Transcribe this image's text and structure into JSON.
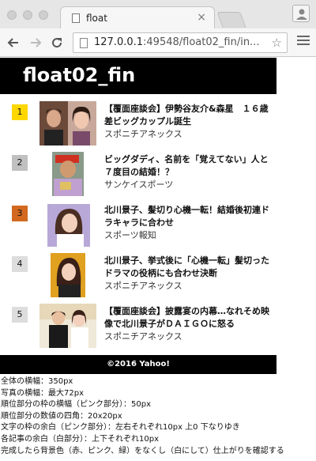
{
  "browser": {
    "tab_title": "float",
    "tab_close": "×",
    "url_host": "127.0.0.1",
    "url_rest": ":49548/float02_fin/in..."
  },
  "colors": {
    "rank_1": "#ffd700",
    "rank_2": "#c0c0c0",
    "rank_3": "#d2691e",
    "rank_other": "#dddddd"
  },
  "header": {
    "title": "float02_fin"
  },
  "news": [
    {
      "rank": "1",
      "headline": "【覆面座談会】伊勢谷友介&森星　１６歳差ビッグカップル誕生",
      "source": "スポニチアネックス"
    },
    {
      "rank": "2",
      "headline": "ビッグダディ、名前を「覚えてない」人と７度目の結婚！？",
      "source": "サンケイスポーツ"
    },
    {
      "rank": "3",
      "headline": "北川景子、髪切り心機一転！結婚後初連ドラキャラに合わせ",
      "source": "スポーツ報知"
    },
    {
      "rank": "4",
      "headline": "北川景子、挙式後に「心機一転」髪切った　ドラマの役柄にも合わせ決断",
      "source": "スポニチアネックス"
    },
    {
      "rank": "5",
      "headline": "【覆面座談会】披露宴の内幕…なれそめ映像で北川景子がＤＡＩＧＯに怒る",
      "source": "スポニチアネックス"
    }
  ],
  "footer": {
    "copyright": "©2016 Yahoo!"
  },
  "notes": [
    "全体の横幅：350px",
    "写真の横幅：最大72px",
    "順位部分の枠の横幅（ピンク部分）：50px",
    "順位部分の数値の四角：20x20px",
    "文字の枠の余白（ピンク部分）：左右それぞれ10px 上0 下なりゆき",
    "各記事の余白（白部分）：上下それぞれ10px",
    "完成したら背景色（赤、ピンク、緑）をなくし（白にして）仕上がりを確認する"
  ]
}
